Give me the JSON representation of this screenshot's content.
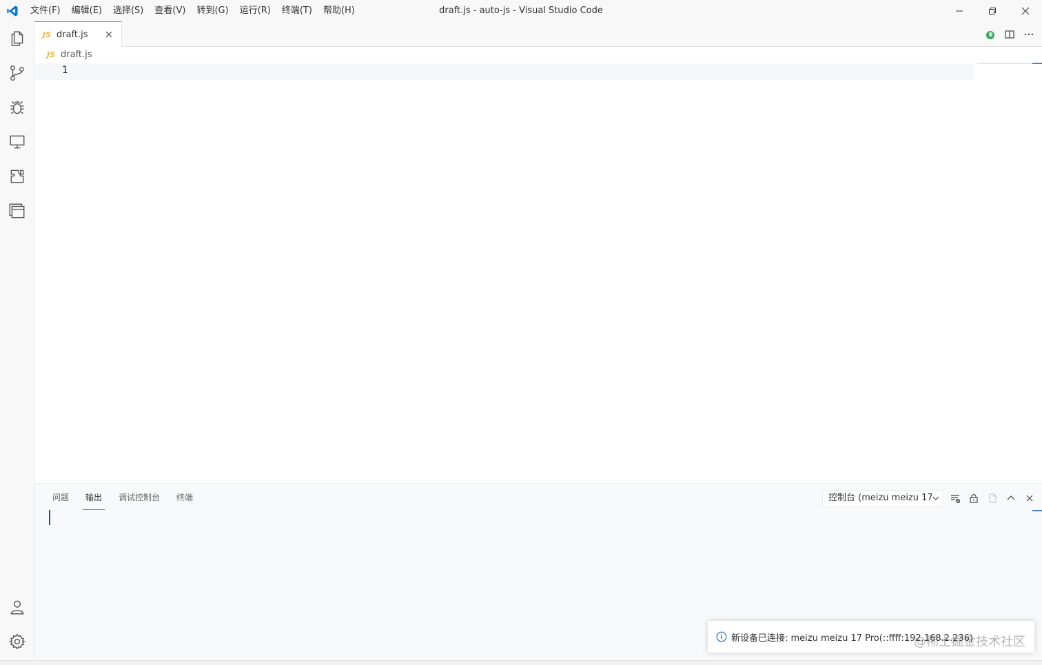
{
  "titlebar": {
    "menu": [
      {
        "label": "文件(F)"
      },
      {
        "label": "编辑(E)"
      },
      {
        "label": "选择(S)"
      },
      {
        "label": "查看(V)"
      },
      {
        "label": "转到(G)"
      },
      {
        "label": "运行(R)"
      },
      {
        "label": "终端(T)"
      },
      {
        "label": "帮助(H)"
      }
    ],
    "window_title": "draft.js - auto-js - Visual Studio Code"
  },
  "tabs": [
    {
      "label": "draft.js",
      "badge": "JS"
    }
  ],
  "breadcrumb": {
    "badge": "JS",
    "label": "draft.js"
  },
  "editor": {
    "line_numbers": [
      "1"
    ]
  },
  "panel": {
    "tabs": [
      {
        "label": "问题"
      },
      {
        "label": "输出"
      },
      {
        "label": "调试控制台"
      },
      {
        "label": "终端"
      }
    ],
    "output_channel": "控制台 (meizu meizu 17"
  },
  "notification": {
    "text": "新设备已连接: meizu meizu 17 Pro(::ffff:192.168.2.236)"
  },
  "watermark": "@稀土掘金技术社区",
  "colors": {
    "accent": "#e25c4c",
    "js_badge": "#e8b44a",
    "vscode_blue": "#0078d4",
    "focus_blue": "#4a7dc9",
    "extension_green": "#3ca55c"
  },
  "icons": {
    "activity": [
      "explorer-icon",
      "source-control-icon",
      "debug-icon",
      "remote-explorer-icon",
      "extensions-icon",
      "panel-layout-icon",
      "account-icon",
      "settings-gear-icon"
    ],
    "editor_actions": [
      "run-extension-icon",
      "split-editor-icon",
      "more-actions-icon"
    ],
    "panel_actions": [
      "clear-output-icon",
      "lock-scroll-icon",
      "open-output-icon",
      "maximize-panel-icon",
      "close-panel-icon"
    ]
  }
}
